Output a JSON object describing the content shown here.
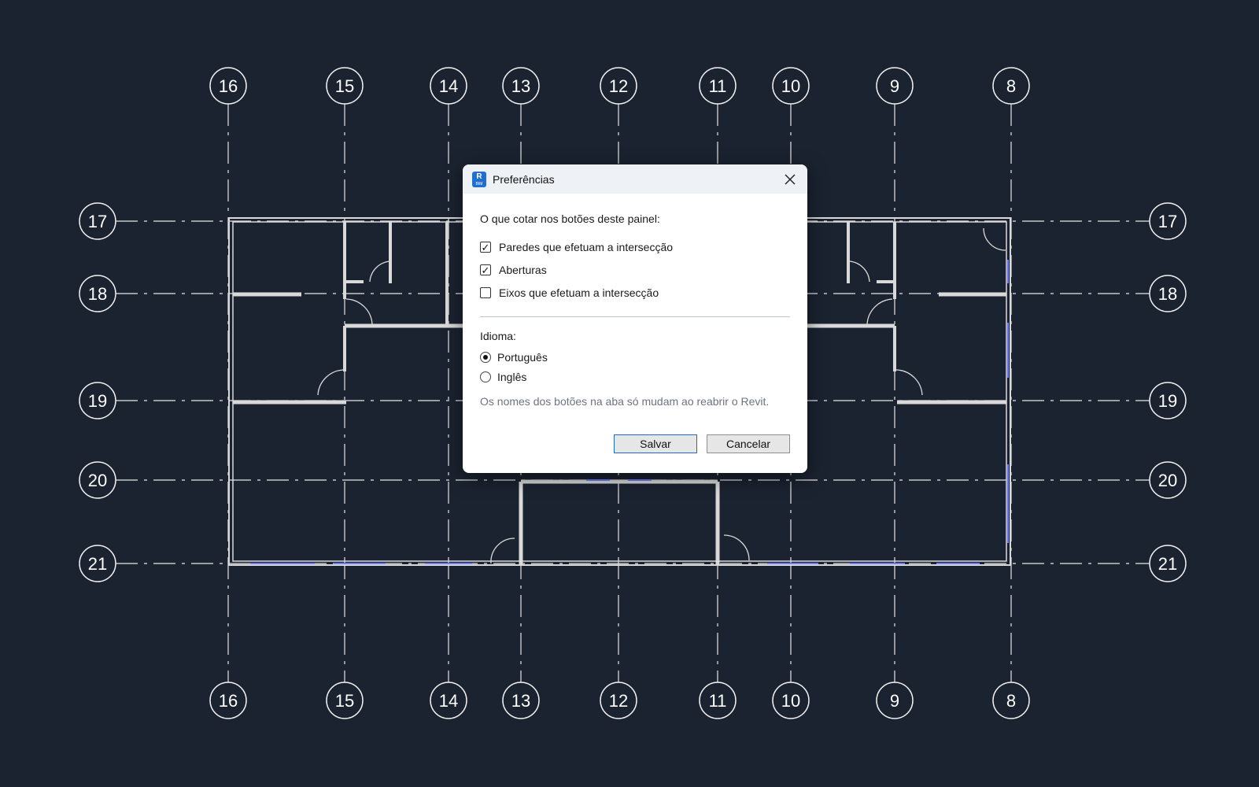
{
  "drawing": {
    "vertical_grids": [
      "16",
      "15",
      "14",
      "13",
      "12",
      "11",
      "10",
      "9",
      "8"
    ],
    "horizontal_grids": [
      "17",
      "18",
      "19",
      "20",
      "21"
    ]
  },
  "dialog": {
    "app_icon_letter": "R",
    "app_icon_sub": "BIM",
    "title": "Preferências",
    "question": "O que cotar nos botões deste painel:",
    "options": [
      {
        "label": "Paredes que efetuam a intersecção",
        "checked": true
      },
      {
        "label": "Aberturas",
        "checked": true
      },
      {
        "label": "Eixos que efetuam a intersecção",
        "checked": false
      }
    ],
    "language_label": "Idioma:",
    "languages": [
      {
        "label": "Português",
        "selected": true
      },
      {
        "label": "Inglês",
        "selected": false
      }
    ],
    "hint": "Os nomes dos botões na aba só mudam ao reabrir o Revit.",
    "save_label": "Salvar",
    "cancel_label": "Cancelar"
  }
}
